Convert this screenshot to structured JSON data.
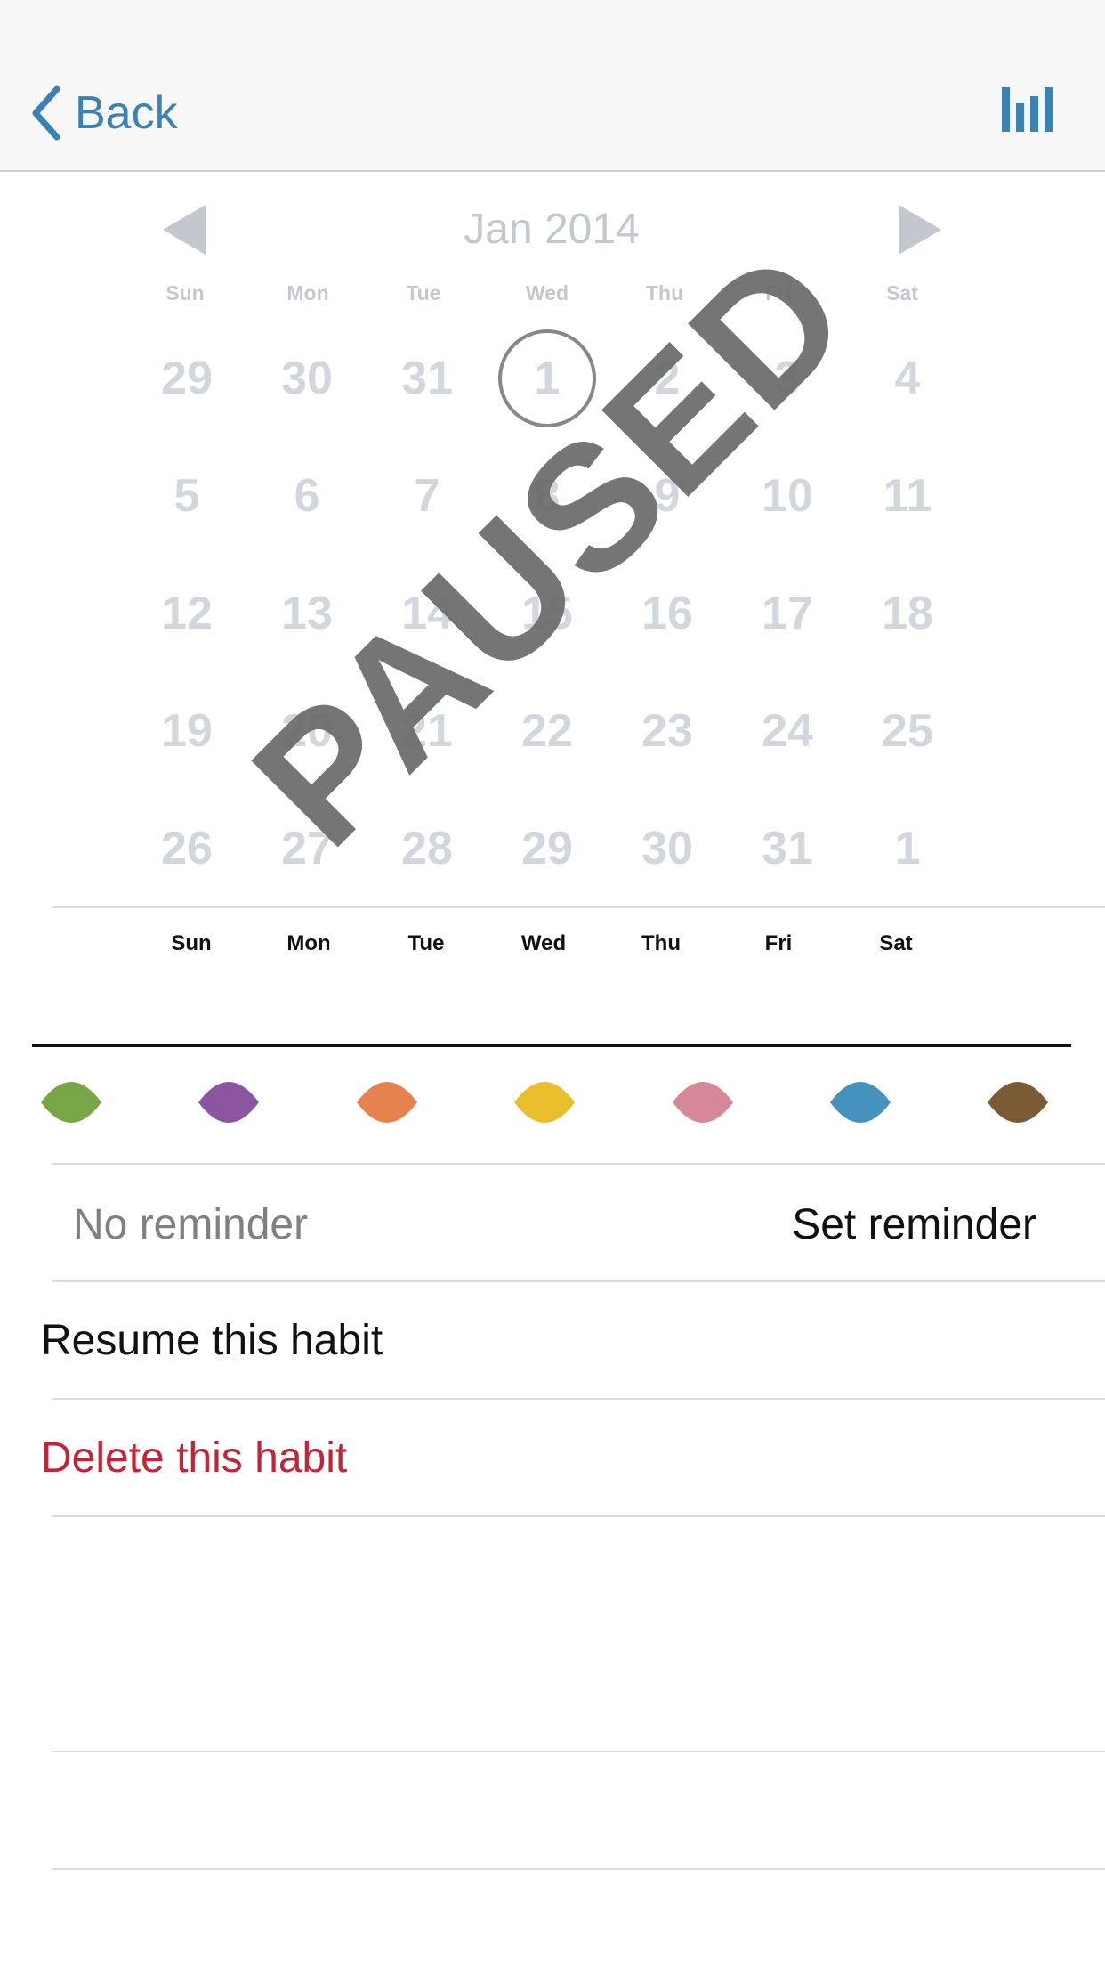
{
  "nav": {
    "back_label": "Back",
    "accent_color": "#3a82b4",
    "right_icon": "bar-chart-icon"
  },
  "calendar": {
    "month_title": "Jan 2014",
    "prev_icon": "triangle-left-icon",
    "next_icon": "triangle-right-icon",
    "weekdays": [
      "Sun",
      "Mon",
      "Tue",
      "Wed",
      "Thu",
      "Fri",
      "Sat"
    ],
    "weeks": [
      [
        "29",
        "30",
        "31",
        "1",
        "2",
        "3",
        "4"
      ],
      [
        "5",
        "6",
        "7",
        "8",
        "9",
        "10",
        "11"
      ],
      [
        "12",
        "13",
        "14",
        "15",
        "16",
        "17",
        "18"
      ],
      [
        "19",
        "20",
        "21",
        "22",
        "23",
        "24",
        "25"
      ],
      [
        "26",
        "27",
        "28",
        "29",
        "30",
        "31",
        "1"
      ]
    ],
    "today": "1",
    "stamp_text": "PAUSED"
  },
  "schedule": {
    "days": [
      "Sun",
      "Mon",
      "Tue",
      "Wed",
      "Thu",
      "Fri",
      "Sat"
    ]
  },
  "colors": [
    {
      "name": "green",
      "hex": "#78a646"
    },
    {
      "name": "purple",
      "hex": "#8b55a0"
    },
    {
      "name": "orange",
      "hex": "#e5824e"
    },
    {
      "name": "yellow",
      "hex": "#e8be2c"
    },
    {
      "name": "pink",
      "hex": "#d68898"
    },
    {
      "name": "blue",
      "hex": "#4592bf"
    },
    {
      "name": "brown",
      "hex": "#7b5a36"
    }
  ],
  "reminder": {
    "status": "No reminder",
    "action": "Set reminder"
  },
  "actions": {
    "resume": "Resume this habit",
    "delete": "Delete this habit",
    "delete_color": "#c0263a"
  }
}
